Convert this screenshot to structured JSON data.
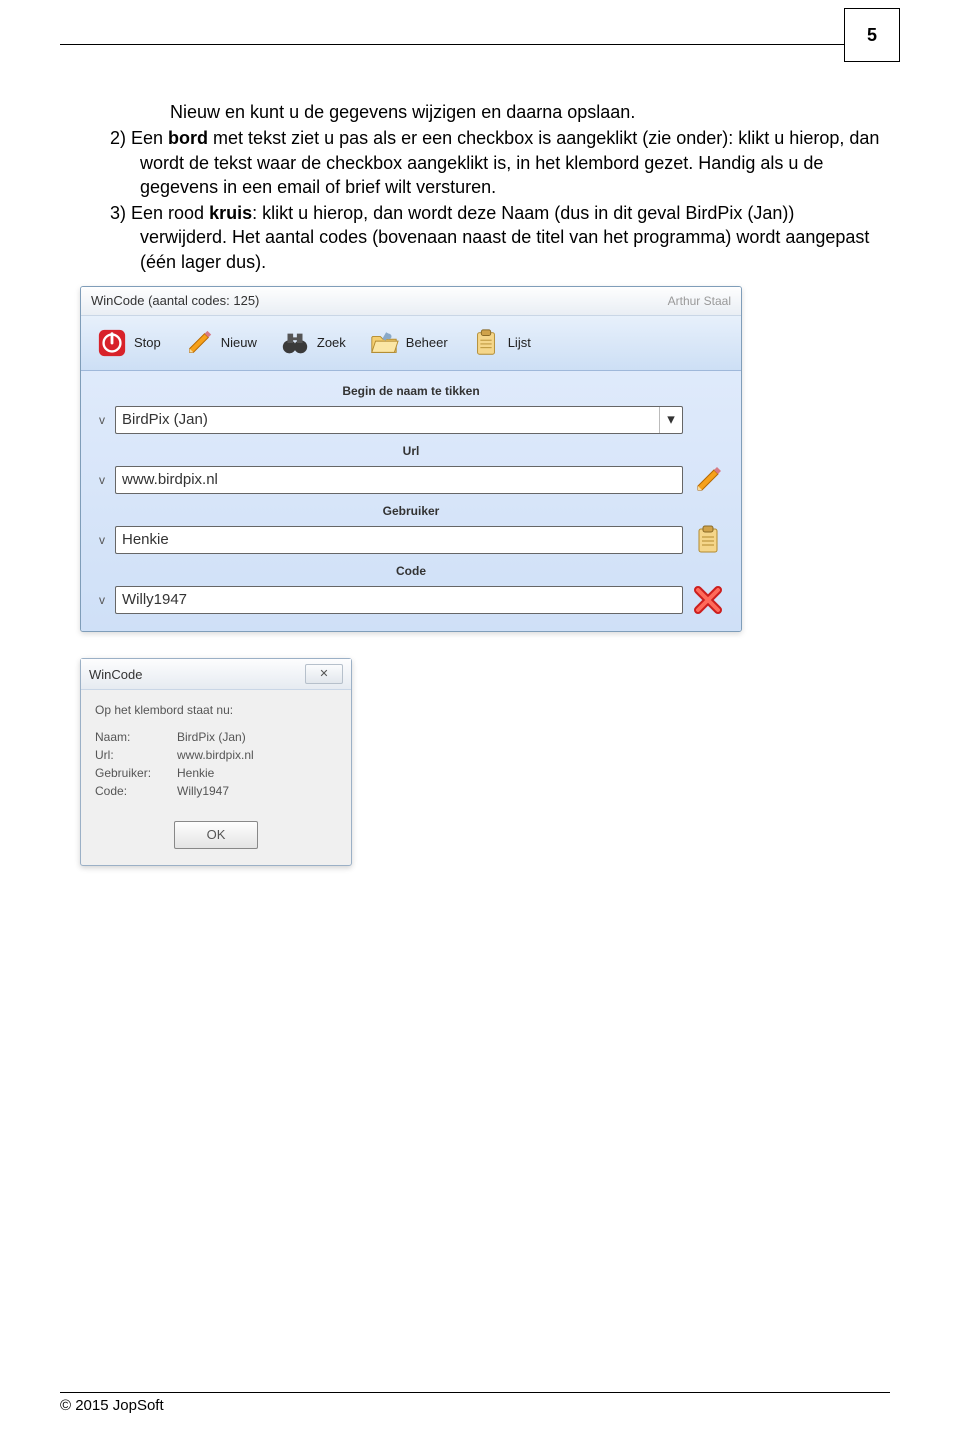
{
  "page_number": "5",
  "paragraphs": {
    "line1": "Nieuw en kunt u de gegevens wijzigen en daarna opslaan.",
    "item2_full": "2) Een bord met tekst ziet u pas als er een checkbox is aangeklikt (zie onder): klikt u hierop, dan wordt de tekst waar de checkbox aangeklikt is, in het klembord gezet. Handig als u de gegevens in een email of brief wilt versturen.",
    "item3_full": "3) Een rood kruis: klikt u hierop, dan wordt deze Naam (dus in dit geval BirdPix (Jan)) verwijderd. Het aantal codes (bovenaan naast de titel van het programma) wordt aangepast (één lager dus)."
  },
  "win1": {
    "title": "WinCode (aantal codes: 125)",
    "title_right": "Arthur Staal",
    "toolbar": {
      "stop": "Stop",
      "nieuw": "Nieuw",
      "zoek": "Zoek",
      "beheer": "Beheer",
      "lijst": "Lijst"
    },
    "labels": {
      "begin": "Begin de naam te tikken",
      "url": "Url",
      "gebruiker": "Gebruiker",
      "code": "Code"
    },
    "values": {
      "name": "BirdPix (Jan)",
      "url": "www.birdpix.nl",
      "user": "Henkie",
      "code": "Willy1947"
    },
    "check": "v",
    "drop_glyph": "▾"
  },
  "win2": {
    "title": "WinCode",
    "close_glyph": "✕",
    "header": "Op het klembord staat nu:",
    "rows": {
      "k_name": "Naam:",
      "v_name": "BirdPix (Jan)",
      "k_url": "Url:",
      "v_url": "www.birdpix.nl",
      "k_user": "Gebruiker:",
      "v_user": "Henkie",
      "k_code": "Code:",
      "v_code": "Willy1947"
    },
    "ok": "OK"
  },
  "footer": "© 2015  JopSoft"
}
